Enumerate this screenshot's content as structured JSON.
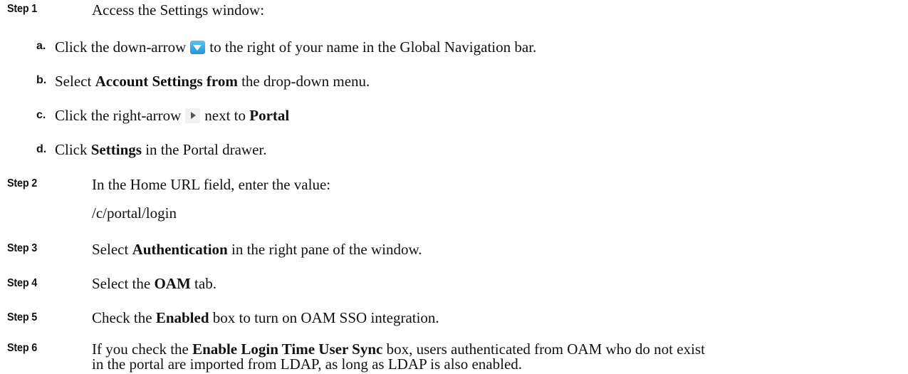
{
  "step1": {
    "label": "Step 1",
    "text": "Access the Settings window:",
    "substeps": {
      "a": {
        "label": "a.",
        "before": "Click the down-arrow",
        "after": "to the right of your name in the Global Navigation bar."
      },
      "b": {
        "label": "b.",
        "before": "Select",
        "bold": "Account Settings from",
        "after": "the drop-down menu."
      },
      "c": {
        "label": "c.",
        "before": "Click the right-arrow",
        "middle": "next to",
        "bold": "Portal"
      },
      "d": {
        "label": "d.",
        "before": "Click",
        "bold": "Settings",
        "after": "in the Portal drawer."
      }
    }
  },
  "step2": {
    "label": "Step 2",
    "text": "In the Home URL field, enter the value:",
    "value": "/c/portal/login"
  },
  "step3": {
    "label": "Step 3",
    "before": "Select",
    "bold": "Authentication",
    "after": "in the right pane of the window."
  },
  "step4": {
    "label": "Step 4",
    "before": "Select the",
    "bold": "OAM",
    "after": "tab."
  },
  "step5": {
    "label": "Step 5",
    "before": "Check the",
    "bold": "Enabled",
    "after": "box to turn on OAM SSO integration."
  },
  "step6": {
    "label": "Step 6",
    "before": "If you check the",
    "bold": "Enable Login Time User Sync",
    "after": "box, users authenticated from OAM who do not exist",
    "line2": "in the portal are imported from LDAP, as long as LDAP is also enabled."
  },
  "icons": {
    "down_arrow": "down-arrow-icon",
    "right_arrow": "right-arrow-icon",
    "down_arrow_color": "#2aa6e3"
  }
}
